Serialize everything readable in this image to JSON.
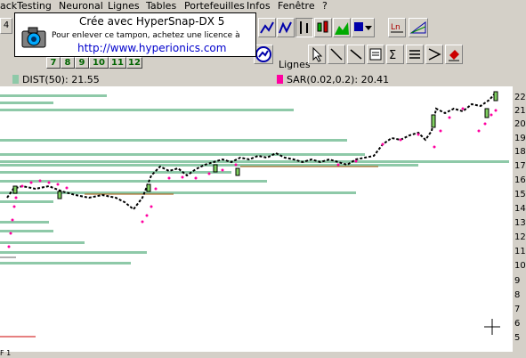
{
  "menu": [
    "ackTesting",
    "Neuronal",
    "Lignes",
    "Tables",
    "Portefeuilles",
    "Infos",
    "Fenêtre",
    "?"
  ],
  "stamp": {
    "line1": "Crée avec HyperSnap-DX 5",
    "line2": "Pour enlever ce tampon, achetez une licence à",
    "line3": "http://www.hyperionics.com"
  },
  "toolbar": {
    "left_partial": "4",
    "lignes_label": "Lignes",
    "period_buttons": [
      "7",
      "8",
      "9",
      "10",
      "11",
      "12"
    ]
  },
  "indicators": {
    "dist": "DIST(50): 21.55",
    "sar": "SAR(0.02,0.2): 20.41"
  },
  "y_ticks": [
    "22",
    "21",
    "20",
    "19",
    "18",
    "17",
    "16",
    "15",
    "14",
    "13",
    "12",
    "11",
    "10",
    "9",
    "8",
    "7",
    "6",
    "5"
  ],
  "bottom_partial": "F 1",
  "colors": {
    "dist": "#8ec9a8",
    "sar": "#ff00a0",
    "price": "#000000"
  }
}
